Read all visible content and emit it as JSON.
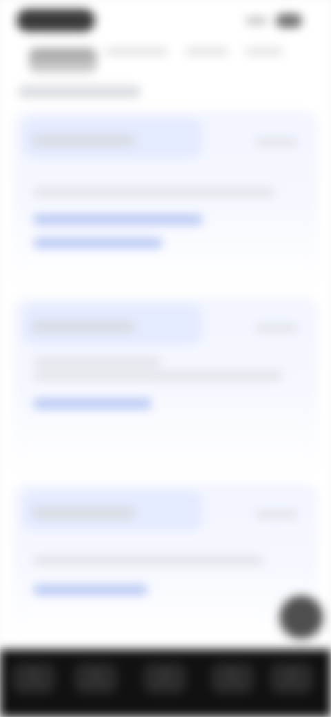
{
  "ui": {
    "colors": {
      "background": "#ffffff",
      "card": "#f4f7ff",
      "accent": "#b8c8f4",
      "bottom_nav": "#111111",
      "fab": "#4f4f4f"
    },
    "icons": {
      "status_pill": "status-pill-icon",
      "signal": "signal-icon",
      "battery": "battery-icon",
      "header": "avatar-icon",
      "fab": "add-icon"
    }
  }
}
